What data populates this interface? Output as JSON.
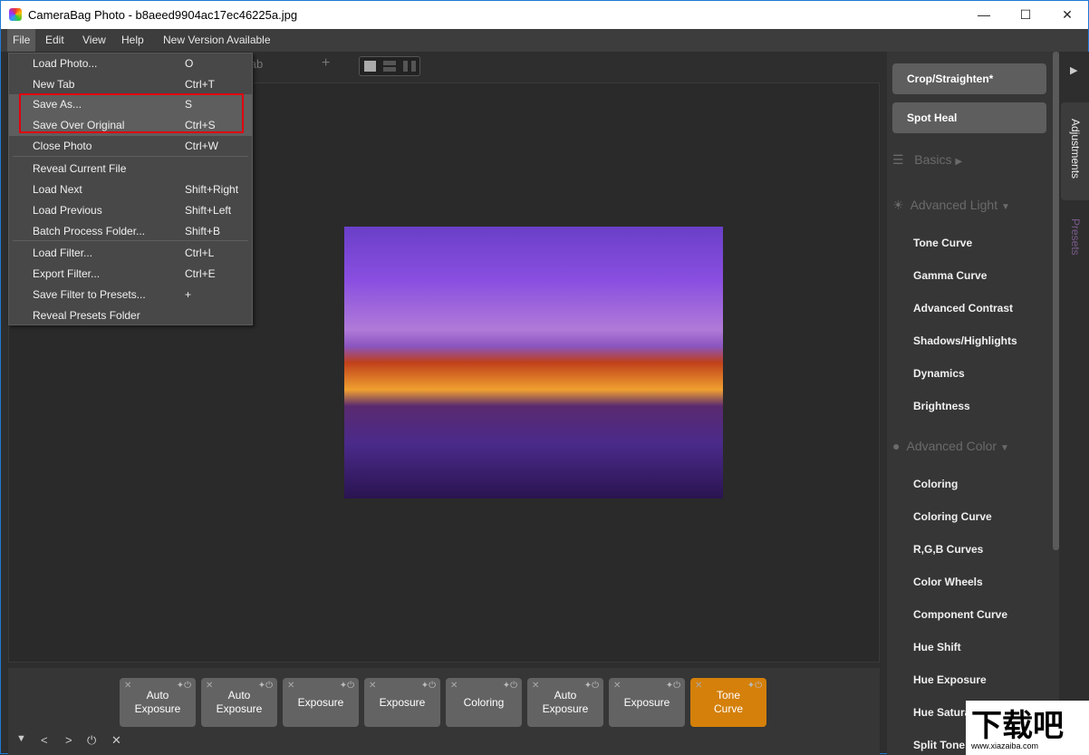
{
  "window": {
    "title": "CameraBag Photo - b8aeed9904ac17ec46225a.jpg",
    "minimize": "—",
    "maximize": "☐",
    "close": "✕"
  },
  "menubar": [
    "File",
    "Edit",
    "View",
    "Help",
    "New Version Available"
  ],
  "tabs": {
    "empty_tab": "Empty Tab",
    "add": "+"
  },
  "file_menu": [
    {
      "label": "Load Photo...",
      "shortcut": "O"
    },
    {
      "label": "New Tab",
      "shortcut": "Ctrl+T"
    },
    {
      "label": "Save As...",
      "shortcut": "S"
    },
    {
      "label": "Save Over Original",
      "shortcut": "Ctrl+S"
    },
    {
      "label": "Close Photo",
      "shortcut": "Ctrl+W"
    },
    {
      "label": "Reveal Current File",
      "shortcut": ""
    },
    {
      "label": "Load Next",
      "shortcut": "Shift+Right"
    },
    {
      "label": "Load Previous",
      "shortcut": "Shift+Left"
    },
    {
      "label": "Batch Process Folder...",
      "shortcut": "Shift+B"
    },
    {
      "label": "Load Filter...",
      "shortcut": "Ctrl+L"
    },
    {
      "label": "Export Filter...",
      "shortcut": "Ctrl+E"
    },
    {
      "label": "Save Filter to Presets...",
      "shortcut": "+"
    },
    {
      "label": "Reveal Presets Folder",
      "shortcut": ""
    }
  ],
  "right_panel": {
    "buttons": [
      "Crop/Straighten*",
      "Spot Heal"
    ],
    "basics": "Basics",
    "advanced_light": "Advanced Light",
    "light_items": [
      "Tone Curve",
      "Gamma Curve",
      "Advanced Contrast",
      "Shadows/Highlights",
      "Dynamics",
      "Brightness"
    ],
    "advanced_color": "Advanced Color",
    "color_items": [
      "Coloring",
      "Coloring Curve",
      "R,G,B Curves",
      "Color Wheels",
      "Component Curve",
      "Hue Shift",
      "Hue Exposure",
      "Hue Saturation",
      "Split Tone"
    ]
  },
  "side_tabs": {
    "adjustments": "Adjustments",
    "presets": "Presets"
  },
  "filter_stack": [
    {
      "label": "Auto Exposure",
      "active": false
    },
    {
      "label": "Auto Exposure",
      "active": false
    },
    {
      "label": "Exposure",
      "active": false
    },
    {
      "label": "Exposure",
      "active": false
    },
    {
      "label": "Coloring",
      "active": false
    },
    {
      "label": "Auto Exposure",
      "active": false
    },
    {
      "label": "Exposure",
      "active": false
    },
    {
      "label": "Tone Curve",
      "active": true
    }
  ],
  "watermark": {
    "text": "下载吧",
    "url": "www.xiazaiba.com"
  },
  "colors": {
    "accent": "#d4800a",
    "highlight_box": "#e00010"
  }
}
